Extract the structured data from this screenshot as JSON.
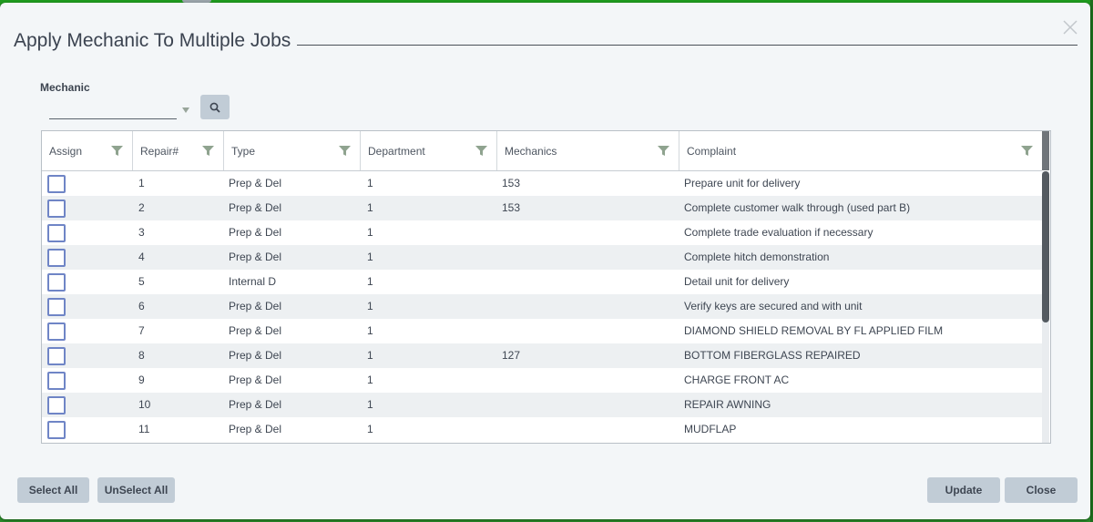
{
  "dialog": {
    "title": "Apply Mechanic To Multiple Jobs"
  },
  "mechanic": {
    "label": "Mechanic",
    "value": "",
    "placeholder": ""
  },
  "columns": [
    "Assign",
    "Repair#",
    "Type",
    "Department",
    "Mechanics",
    "Complaint"
  ],
  "rows": [
    {
      "assigned": false,
      "repair": "1",
      "type": "Prep & Del",
      "department": "1",
      "mechanics": "153",
      "complaint": "Prepare unit for delivery"
    },
    {
      "assigned": false,
      "repair": "2",
      "type": "Prep & Del",
      "department": "1",
      "mechanics": "153",
      "complaint": "Complete customer walk through (used part B)"
    },
    {
      "assigned": false,
      "repair": "3",
      "type": "Prep & Del",
      "department": "1",
      "mechanics": "",
      "complaint": "Complete trade evaluation if necessary"
    },
    {
      "assigned": false,
      "repair": "4",
      "type": "Prep & Del",
      "department": "1",
      "mechanics": "",
      "complaint": "Complete hitch demonstration"
    },
    {
      "assigned": false,
      "repair": "5",
      "type": "Internal D",
      "department": "1",
      "mechanics": "",
      "complaint": "Detail unit for delivery"
    },
    {
      "assigned": false,
      "repair": "6",
      "type": "Prep & Del",
      "department": "1",
      "mechanics": "",
      "complaint": "Verify keys are secured and with unit"
    },
    {
      "assigned": false,
      "repair": "7",
      "type": "Prep & Del",
      "department": "1",
      "mechanics": "",
      "complaint": "DIAMOND SHIELD REMOVAL BY FL APPLIED FILM"
    },
    {
      "assigned": false,
      "repair": "8",
      "type": "Prep & Del",
      "department": "1",
      "mechanics": "127",
      "complaint": "BOTTOM FIBERGLASS REPAIRED"
    },
    {
      "assigned": false,
      "repair": "9",
      "type": "Prep & Del",
      "department": "1",
      "mechanics": "",
      "complaint": "CHARGE FRONT AC"
    },
    {
      "assigned": false,
      "repair": "10",
      "type": "Prep & Del",
      "department": "1",
      "mechanics": "",
      "complaint": "REPAIR AWNING"
    },
    {
      "assigned": false,
      "repair": "11",
      "type": "Prep & Del",
      "department": "1",
      "mechanics": "",
      "complaint": "MUDFLAP"
    }
  ],
  "buttons": {
    "select_all": "Select All",
    "unselect_all": "UnSelect All",
    "update": "Update",
    "close": "Close"
  },
  "icons": {
    "close": "close-icon",
    "search": "search-icon",
    "filter": "filter-icon",
    "dropdown": "chevron-down-icon"
  },
  "colors": {
    "header_bar": "#1f9a1f",
    "button_bg": "#c1ccd6",
    "checkbox_border": "#6f85c6",
    "filter_icon": "#8fa38f",
    "row_alt": "#edf0f2"
  }
}
